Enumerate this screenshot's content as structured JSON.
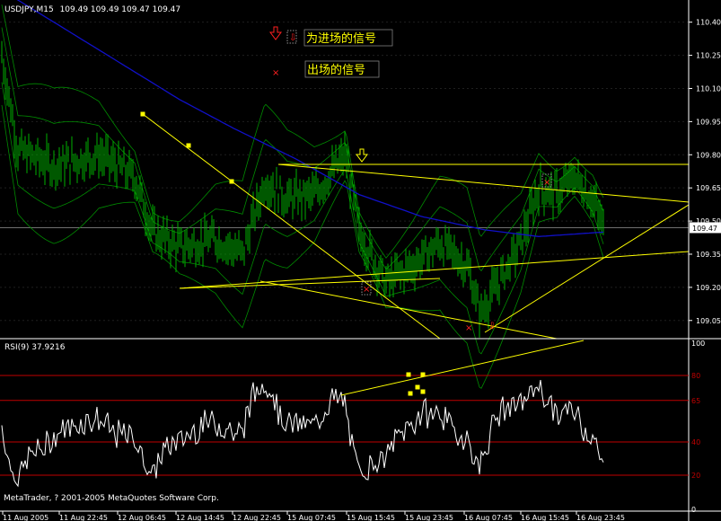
{
  "main_chart": {
    "symbol_label": "USDJPY,M15",
    "ohlc_text": "109.49 109.49 109.47 109.47",
    "current_price": "109.47",
    "price_ticks": [
      "110.40",
      "110.25",
      "110.10",
      "109.95",
      "109.80",
      "109.65",
      "109.50",
      "109.35",
      "109.20",
      "109.05"
    ],
    "price_tick_values": [
      110.4,
      110.25,
      110.1,
      109.95,
      109.8,
      109.65,
      109.5,
      109.35,
      109.2,
      109.05
    ],
    "ylim": [
      108.98,
      110.48
    ],
    "legend_entry_signal": "为进场的信号",
    "legend_exit_signal": "出场的信号"
  },
  "rsi_panel": {
    "label": "RSI(9) 37.9216",
    "scale_ticks": [
      "100",
      "80",
      "65",
      "40",
      "20",
      "0"
    ],
    "level_lines": [
      80,
      65,
      40,
      20
    ],
    "level_line_labels": [
      "80",
      "65",
      "40",
      "20"
    ]
  },
  "time_axis": {
    "labels": [
      "11 Aug 2005",
      "11 Aug 22:45",
      "12 Aug 06:45",
      "12 Aug 14:45",
      "12 Aug 22:45",
      "15 Aug 07:45",
      "15 Aug 15:45",
      "15 Aug 23:45",
      "16 Aug 07:45",
      "16 Aug 15:45",
      "16 Aug 23:45"
    ]
  },
  "copyright": "MetaTrader, ? 2001-2005 MetaQuotes Software Corp.",
  "colors": {
    "background": "#000000",
    "price_bars": "#00b000",
    "moving_average": "#1010c8",
    "bands": "#00a000",
    "trendlines": "#ffff00",
    "rsi_line": "#ffffff",
    "rsi_levels": "#c00000",
    "signal_markers": "#ff2020",
    "text": "#ffffff"
  },
  "chart_data": [
    {
      "type": "line",
      "title": "USDJPY,M15",
      "series": [
        {
          "name": "USDJPY,M15",
          "x_labels": [
            "11 Aug 2005",
            "11 Aug 22:45",
            "12 Aug 06:45",
            "12 Aug 14:45",
            "12 Aug 22:45",
            "15 Aug 07:45",
            "15 Aug 15:45",
            "15 Aug 23:45",
            "16 Aug 07:45",
            "16 Aug 15:45",
            "16 Aug 23:45"
          ],
          "close": [
            110.3,
            109.82,
            109.8,
            109.38,
            109.7,
            109.55,
            109.25,
            109.4,
            109.08,
            109.65,
            109.47
          ]
        }
      ],
      "ylim": [
        108.98,
        110.48
      ],
      "grid": true
    },
    {
      "type": "line",
      "title": "RSI(9) 37.9216",
      "series": [
        {
          "name": "RSI(9)",
          "x_labels": [
            "11 Aug 2005",
            "11 Aug 22:45",
            "12 Aug 06:45",
            "12 Aug 14:45",
            "12 Aug 22:45",
            "15 Aug 07:45",
            "15 Aug 15:45",
            "15 Aug 23:45",
            "16 Aug 07:45",
            "16 Aug 15:45",
            "16 Aug 23:45"
          ],
          "values": [
            40,
            60,
            30,
            55,
            65,
            45,
            35,
            70,
            25,
            70,
            37.9
          ]
        }
      ],
      "ylim": [
        0,
        100
      ]
    }
  ]
}
